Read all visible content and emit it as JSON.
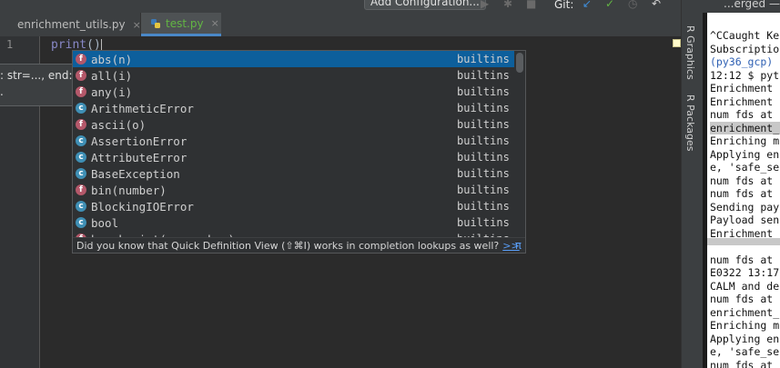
{
  "toolbar": {
    "add_configuration_label": "Add Configuration...",
    "git_label": "Git:"
  },
  "tabs": [
    {
      "label": "enrichment_utils.py",
      "close": "×"
    },
    {
      "label": "test.py",
      "close": "×"
    }
  ],
  "editor": {
    "line_number": "1",
    "code_keyword": "print",
    "code_rest": "()"
  },
  "param_hint": {
    "line1": ": str=..., end:",
    "line2": "."
  },
  "completion": {
    "items": [
      {
        "kind": "f",
        "name": "abs(n)",
        "module": "builtins",
        "selected": true
      },
      {
        "kind": "f",
        "name": "all(i)",
        "module": "builtins"
      },
      {
        "kind": "f",
        "name": "any(i)",
        "module": "builtins"
      },
      {
        "kind": "c",
        "name": "ArithmeticError",
        "module": "builtins"
      },
      {
        "kind": "f",
        "name": "ascii(o)",
        "module": "builtins"
      },
      {
        "kind": "c",
        "name": "AssertionError",
        "module": "builtins"
      },
      {
        "kind": "c",
        "name": "AttributeError",
        "module": "builtins"
      },
      {
        "kind": "c",
        "name": "BaseException",
        "module": "builtins"
      },
      {
        "kind": "f",
        "name": "bin(number)",
        "module": "builtins"
      },
      {
        "kind": "c",
        "name": "BlockingIOError",
        "module": "builtins"
      },
      {
        "kind": "c",
        "name": "bool",
        "module": "builtins"
      },
      {
        "kind": "f",
        "name": "breakpoint(args, kws)",
        "module": "builtins"
      }
    ],
    "footer_text": "Did you know that Quick Definition View (⇧⌘I) works in completion lookups as well?",
    "footer_link": ">>",
    "footer_pi": "π"
  },
  "right_strip": {
    "r_graphics": "R Graphics",
    "r_packages": "R Packages"
  },
  "terminal": {
    "title": "...erged —",
    "lines": [
      {
        "text": "^CCaught Ke",
        "style": ""
      },
      {
        "text": "Subscriptio",
        "style": ""
      },
      {
        "text": "(py36_gcp) (",
        "style": "blue"
      },
      {
        "text": "12:12 $ pyt",
        "style": ""
      },
      {
        "text": "Enrichment",
        "style": ""
      },
      {
        "text": "Enrichment",
        "style": ""
      },
      {
        "text": "num fds at",
        "style": ""
      },
      {
        "text": "enrichment_",
        "style": "hl"
      },
      {
        "text": "Enriching m",
        "style": ""
      },
      {
        "text": "Applying en",
        "style": ""
      },
      {
        "text": "e, 'safe_se",
        "style": ""
      },
      {
        "text": "num fds at",
        "style": ""
      },
      {
        "text": "num fds at",
        "style": ""
      },
      {
        "text": "Sending pay",
        "style": ""
      },
      {
        "text": "Payload sen",
        "style": ""
      },
      {
        "text": "Enrichment",
        "style": ""
      },
      {
        "text": "",
        "style": ""
      },
      {
        "text": "num fds at",
        "style": ""
      },
      {
        "text": "E0322 13:17",
        "style": ""
      },
      {
        "text": "CALM and de",
        "style": ""
      },
      {
        "text": "num fds at",
        "style": ""
      },
      {
        "text": "enrichment_",
        "style": ""
      },
      {
        "text": "Enriching m",
        "style": ""
      },
      {
        "text": "Applying en",
        "style": ""
      },
      {
        "text": "e, 'safe_se",
        "style": ""
      },
      {
        "text": "num fds at",
        "style": ""
      }
    ]
  }
}
